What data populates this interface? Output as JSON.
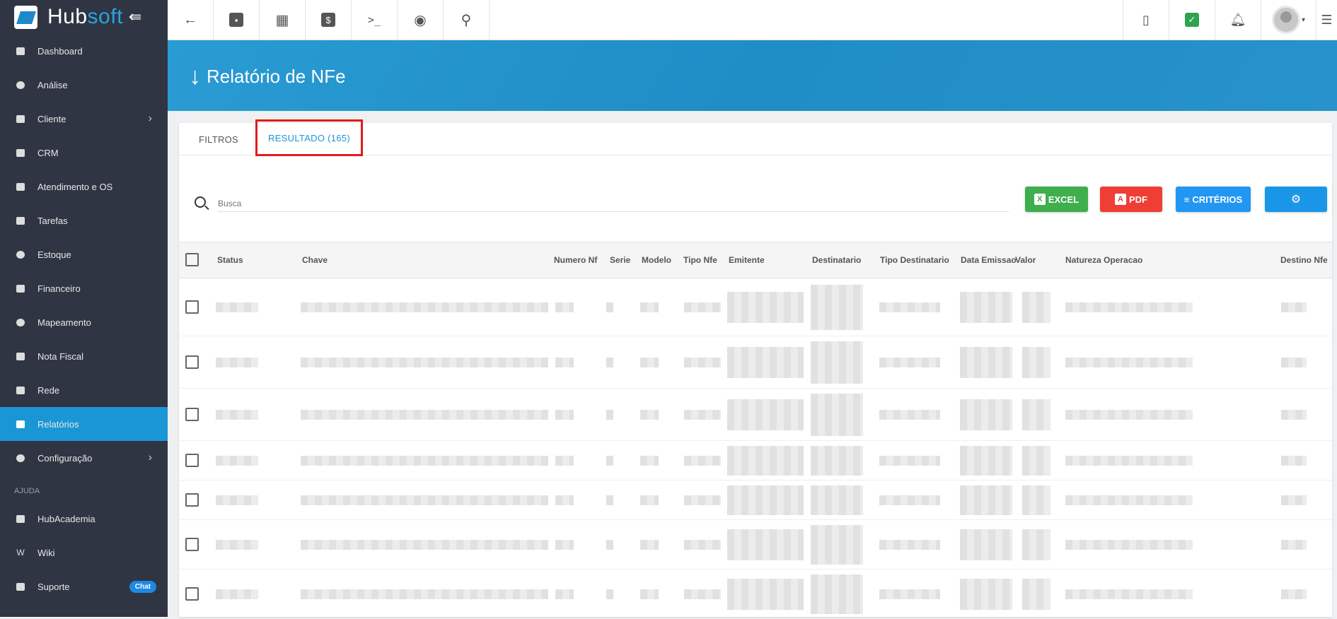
{
  "app": {
    "name_part1": "Hub",
    "name_part2": "soft"
  },
  "sidebar": {
    "items": [
      {
        "label": "Dashboard",
        "icon": "dashboard-icon"
      },
      {
        "label": "Análise",
        "icon": "pie-chart-icon"
      },
      {
        "label": "Cliente",
        "icon": "contact-card-icon",
        "has_submenu": true
      },
      {
        "label": "CRM",
        "icon": "board-icon"
      },
      {
        "label": "Atendimento e OS",
        "icon": "calendar-clock-icon"
      },
      {
        "label": "Tarefas",
        "icon": "calendar-icon"
      },
      {
        "label": "Estoque",
        "icon": "box-icon"
      },
      {
        "label": "Financeiro",
        "icon": "money-icon"
      },
      {
        "label": "Mapeamento",
        "icon": "map-pin-icon"
      },
      {
        "label": "Nota Fiscal",
        "icon": "receipt-icon"
      },
      {
        "label": "Rede",
        "icon": "server-icon"
      },
      {
        "label": "Relatórios",
        "icon": "document-icon",
        "active": true
      },
      {
        "label": "Configuração",
        "icon": "gear-icon",
        "has_submenu": true
      }
    ],
    "section_label": "AJUDA",
    "help_items": [
      {
        "label": "HubAcademia",
        "icon": "play-icon"
      },
      {
        "label": "Wiki",
        "icon": "wiki-icon"
      },
      {
        "label": "Suporte",
        "icon": "chat-icon",
        "badge": "Chat"
      }
    ]
  },
  "page": {
    "title": "Relatório de NFe"
  },
  "tabs": [
    {
      "label": "FILTROS",
      "active": false
    },
    {
      "label": "RESULTADO (165)",
      "active": true
    }
  ],
  "search": {
    "placeholder": "Busca"
  },
  "buttons": {
    "excel": "EXCEL",
    "pdf": "PDF",
    "criterios": "CRITÉRIOS"
  },
  "table": {
    "columns": [
      "Status",
      "Chave",
      "Numero Nf",
      "Serie",
      "Modelo",
      "Tipo Nfe",
      "Emitente",
      "Destinatario",
      "Tipo Destinatario",
      "Data Emissao",
      "Valor",
      "Natureza Operacao",
      "Destino Nfe"
    ]
  },
  "colors": {
    "sidebar_bg": "#2f3542",
    "accent": "#1a96d6",
    "excel": "#3fae4c",
    "pdf": "#ef3e36",
    "highlight": "#e31b1b"
  }
}
